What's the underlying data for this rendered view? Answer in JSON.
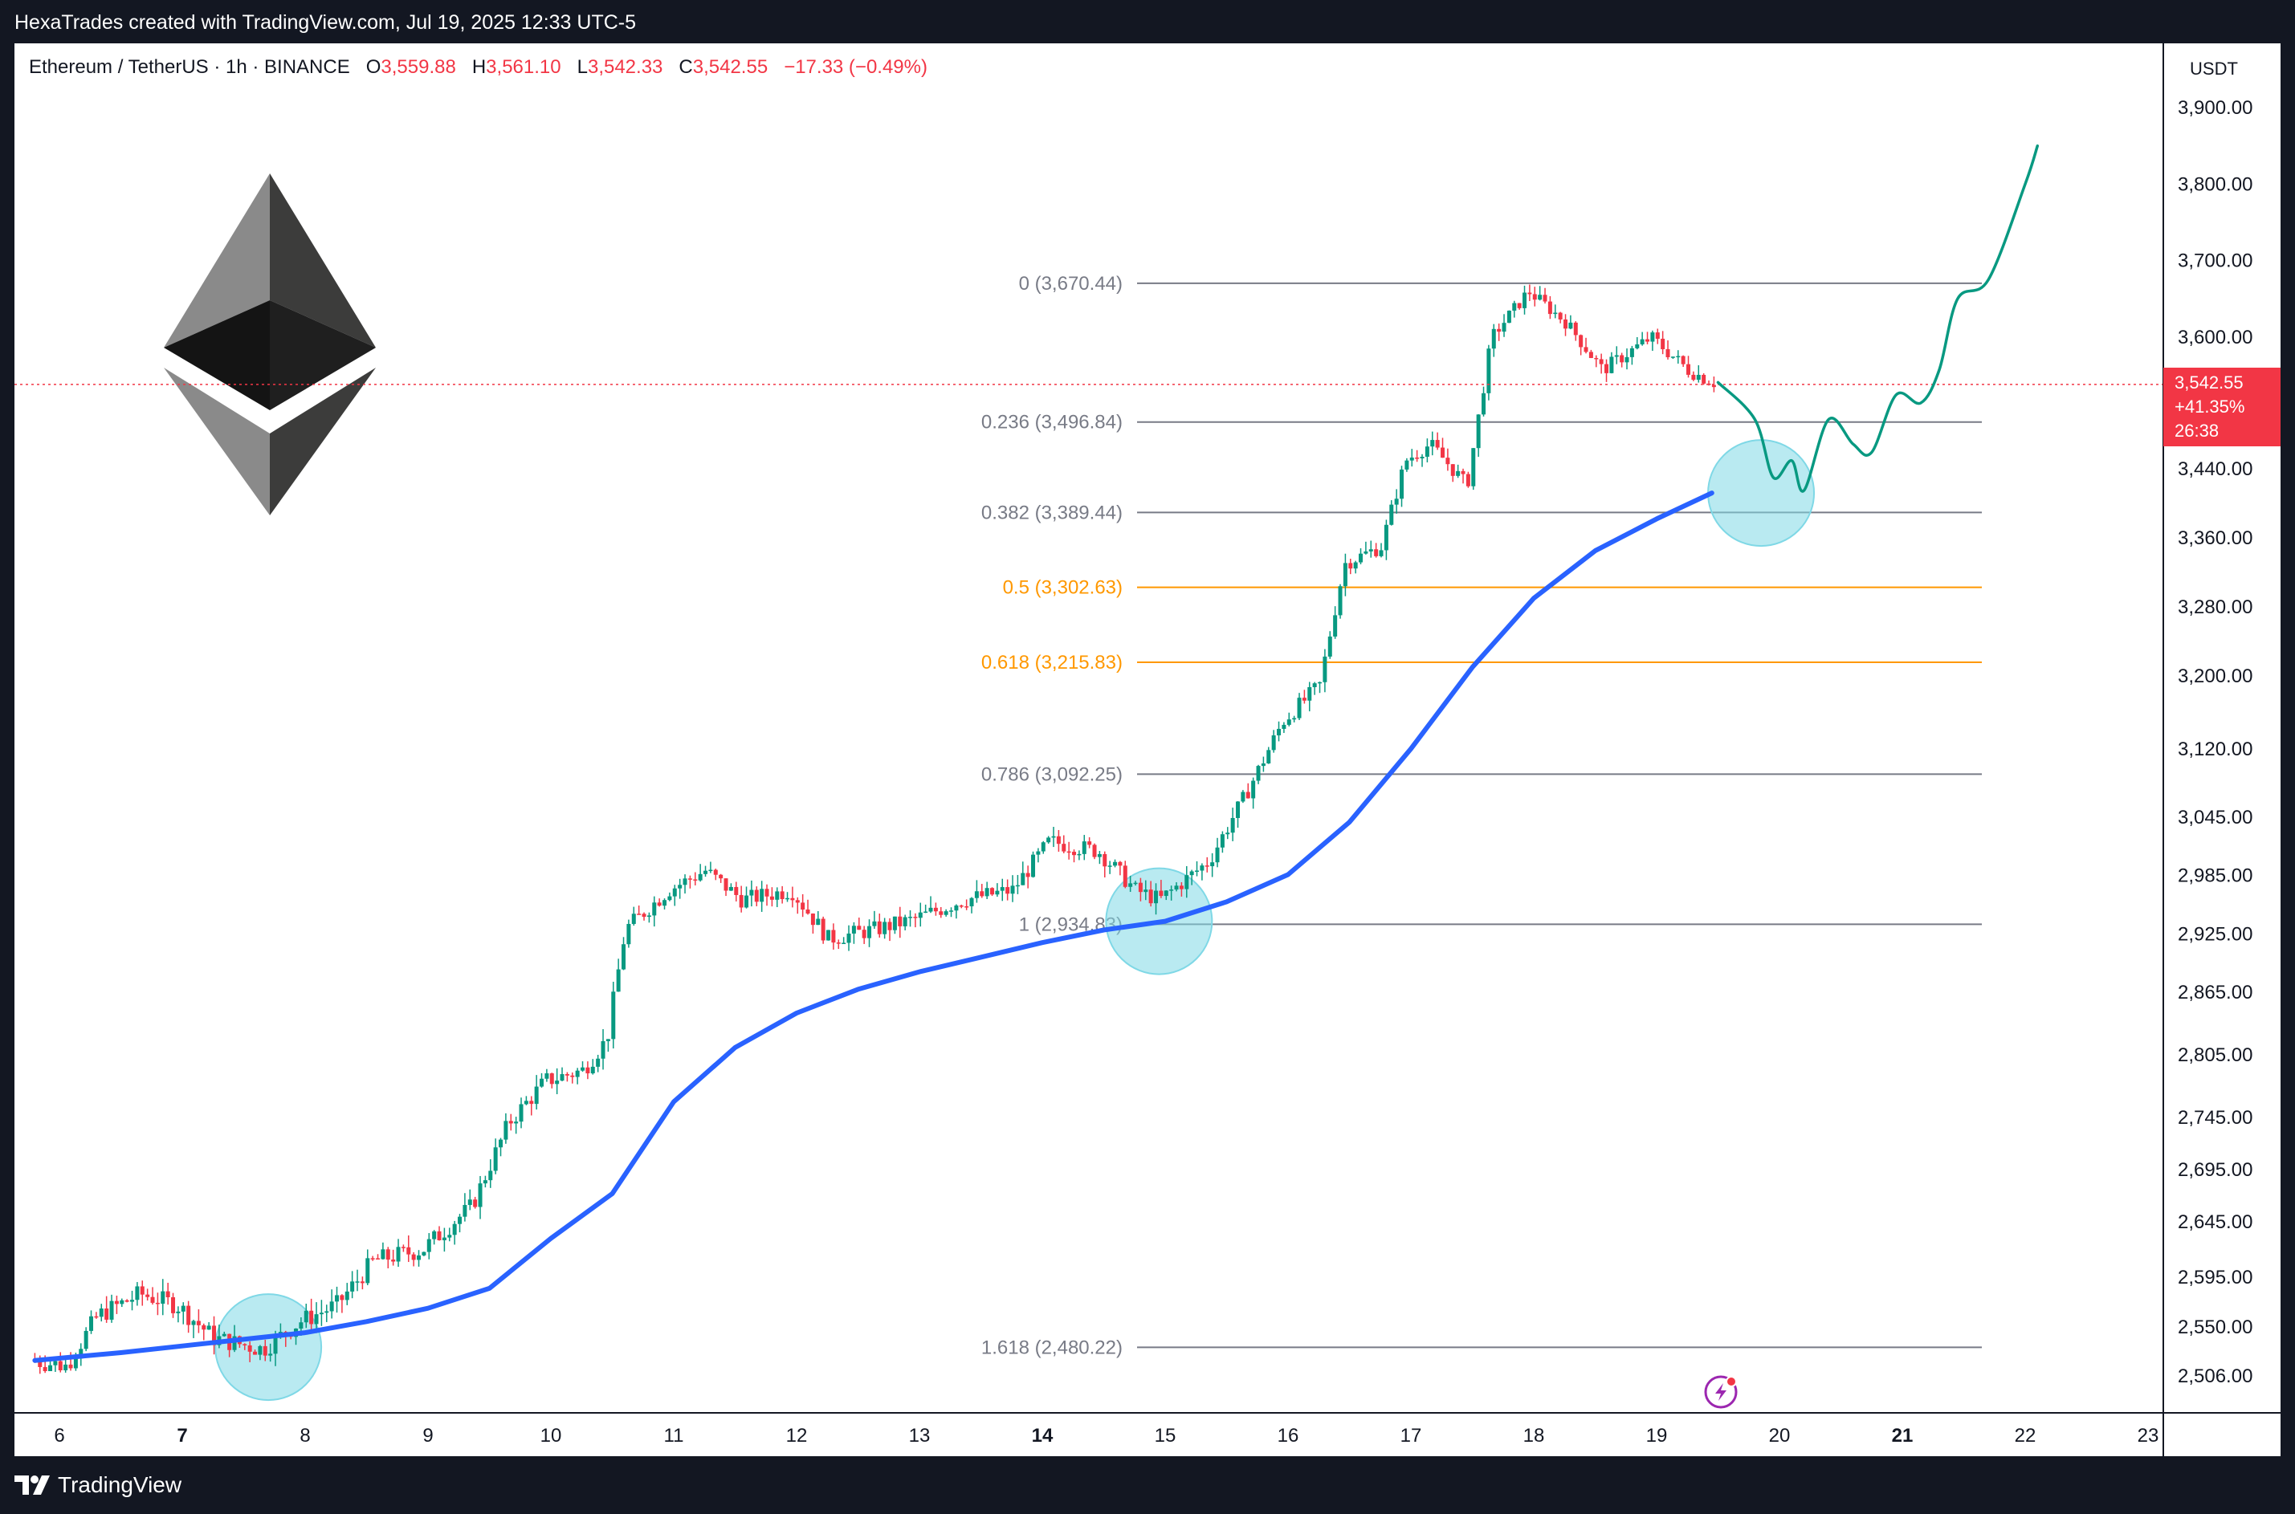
{
  "header": {
    "attribution": "HexaTrades created with TradingView.com, Jul 19, 2025 12:33 UTC-5"
  },
  "legend": {
    "symbol": "Ethereum / TetherUS · 1h · BINANCE",
    "open_label": "O",
    "open": "3,559.88",
    "high_label": "H",
    "high": "3,561.10",
    "low_label": "L",
    "low": "3,542.33",
    "close_label": "C",
    "close": "3,542.55",
    "change": "−17.33 (−0.49%)"
  },
  "price_axis": {
    "currency": "USDT",
    "current_price": "3,542.55",
    "current_change": "+41.35%",
    "countdown": "26:38"
  },
  "footer": {
    "brand": "TradingView"
  },
  "colors": {
    "up": "#089981",
    "down": "#f23645",
    "ema": "#2962ff",
    "fib_gray": "#787b86",
    "fib_orange": "#ff9800",
    "projection": "#089981",
    "highlight": "#7fd8e6"
  },
  "icons": [
    "ethereum-logo-icon",
    "lightning-icon",
    "tradingview-logo-icon"
  ],
  "chart_data": {
    "type": "candlestick",
    "y_tick_labels": [
      "3,900.00",
      "3,800.00",
      "3,700.00",
      "3,600.00",
      "3,440.00",
      "3,360.00",
      "3,280.00",
      "3,200.00",
      "3,120.00",
      "3,045.00",
      "2,985.00",
      "2,925.00",
      "2,865.00",
      "2,805.00",
      "2,745.00",
      "2,695.00",
      "2,645.00",
      "2,595.00",
      "2,550.00",
      "2,506.00"
    ],
    "x_tick_labels": [
      {
        "label": "6",
        "day": 6,
        "bold": false
      },
      {
        "label": "7",
        "day": 7,
        "bold": true
      },
      {
        "label": "8",
        "day": 8,
        "bold": false
      },
      {
        "label": "9",
        "day": 9,
        "bold": false
      },
      {
        "label": "10",
        "day": 10,
        "bold": false
      },
      {
        "label": "11",
        "day": 11,
        "bold": false
      },
      {
        "label": "12",
        "day": 12,
        "bold": false
      },
      {
        "label": "13",
        "day": 13,
        "bold": false
      },
      {
        "label": "14",
        "day": 14,
        "bold": true
      },
      {
        "label": "15",
        "day": 15,
        "bold": false
      },
      {
        "label": "16",
        "day": 16,
        "bold": false
      },
      {
        "label": "17",
        "day": 17,
        "bold": false
      },
      {
        "label": "18",
        "day": 18,
        "bold": false
      },
      {
        "label": "19",
        "day": 19,
        "bold": false
      },
      {
        "label": "20",
        "day": 20,
        "bold": false
      },
      {
        "label": "21",
        "day": 21,
        "bold": true
      },
      {
        "label": "22",
        "day": 22,
        "bold": false
      },
      {
        "label": "23",
        "day": 23,
        "bold": false
      }
    ],
    "fib_levels": [
      {
        "label": "0 (3,670.44)",
        "price": 3670.44,
        "color": "gray"
      },
      {
        "label": "0.236 (3,496.84)",
        "price": 3496.84,
        "color": "gray"
      },
      {
        "label": "0.382 (3,389.44)",
        "price": 3389.44,
        "color": "gray"
      },
      {
        "label": "0.5 (3,302.63)",
        "price": 3302.63,
        "color": "orange"
      },
      {
        "label": "0.618 (3,215.83)",
        "price": 3215.83,
        "color": "orange"
      },
      {
        "label": "0.786 (3,092.25)",
        "price": 3092.25,
        "color": "gray"
      },
      {
        "label": "1 (2,934.83)",
        "price": 2934.83,
        "color": "gray"
      },
      {
        "label": "1.618 (2,480.22)",
        "price": 2480.22,
        "color": "gray"
      }
    ],
    "price_keypoints": [
      [
        5.8,
        2520
      ],
      [
        6.1,
        2515
      ],
      [
        6.35,
        2560
      ],
      [
        6.7,
        2580
      ],
      [
        7.0,
        2570
      ],
      [
        7.3,
        2540
      ],
      [
        7.7,
        2530
      ],
      [
        8.0,
        2555
      ],
      [
        8.3,
        2570
      ],
      [
        8.6,
        2610
      ],
      [
        9.0,
        2620
      ],
      [
        9.4,
        2660
      ],
      [
        9.7,
        2740
      ],
      [
        10.0,
        2780
      ],
      [
        10.3,
        2790
      ],
      [
        10.5,
        2820
      ],
      [
        10.65,
        2930
      ],
      [
        11.0,
        2970
      ],
      [
        11.3,
        2990
      ],
      [
        11.6,
        2960
      ],
      [
        12.0,
        2970
      ],
      [
        12.3,
        2920
      ],
      [
        12.7,
        2930
      ],
      [
        13.0,
        2940
      ],
      [
        13.4,
        2960
      ],
      [
        13.8,
        2970
      ],
      [
        14.1,
        3020
      ],
      [
        14.5,
        3010
      ],
      [
        14.8,
        2970
      ],
      [
        15.0,
        2960
      ],
      [
        15.4,
        3000
      ],
      [
        15.7,
        3070
      ],
      [
        16.0,
        3150
      ],
      [
        16.3,
        3190
      ],
      [
        16.5,
        3330
      ],
      [
        16.8,
        3350
      ],
      [
        17.0,
        3450
      ],
      [
        17.2,
        3470
      ],
      [
        17.5,
        3420
      ],
      [
        17.7,
        3600
      ],
      [
        18.0,
        3660
      ],
      [
        18.3,
        3620
      ],
      [
        18.6,
        3560
      ],
      [
        19.0,
        3600
      ],
      [
        19.3,
        3560
      ],
      [
        19.5,
        3545
      ]
    ],
    "ema_points": [
      [
        5.8,
        2520
      ],
      [
        6.5,
        2527
      ],
      [
        7.0,
        2533
      ],
      [
        7.5,
        2539
      ],
      [
        8.0,
        2545
      ],
      [
        8.5,
        2555
      ],
      [
        9.0,
        2567
      ],
      [
        9.5,
        2585
      ],
      [
        10.0,
        2630
      ],
      [
        10.5,
        2672
      ],
      [
        11.0,
        2760
      ],
      [
        11.5,
        2812
      ],
      [
        12.0,
        2845
      ],
      [
        12.5,
        2868
      ],
      [
        13.0,
        2886
      ],
      [
        13.5,
        2901
      ],
      [
        14.0,
        2916
      ],
      [
        14.5,
        2929
      ],
      [
        15.0,
        2938
      ],
      [
        15.5,
        2958
      ],
      [
        16.0,
        2986
      ],
      [
        16.5,
        3040
      ],
      [
        17.0,
        3120
      ],
      [
        17.5,
        3210
      ],
      [
        18.0,
        3290
      ],
      [
        18.5,
        3345
      ],
      [
        19.0,
        3382
      ],
      [
        19.45,
        3412
      ]
    ],
    "projection_points": [
      [
        19.5,
        3545
      ],
      [
        19.8,
        3500
      ],
      [
        19.95,
        3430
      ],
      [
        20.1,
        3450
      ],
      [
        20.2,
        3415
      ],
      [
        20.4,
        3500
      ],
      [
        20.6,
        3470
      ],
      [
        20.75,
        3460
      ],
      [
        20.95,
        3530
      ],
      [
        21.15,
        3520
      ],
      [
        21.3,
        3560
      ],
      [
        21.45,
        3650
      ],
      [
        21.7,
        3675
      ],
      [
        22.0,
        3800
      ],
      [
        22.1,
        3850
      ]
    ],
    "highlight_circles": [
      {
        "day": 7.7,
        "price": 2532
      },
      {
        "day": 14.95,
        "price": 2938
      },
      {
        "day": 19.85,
        "price": 3412
      }
    ],
    "last_price": 3542.55
  }
}
